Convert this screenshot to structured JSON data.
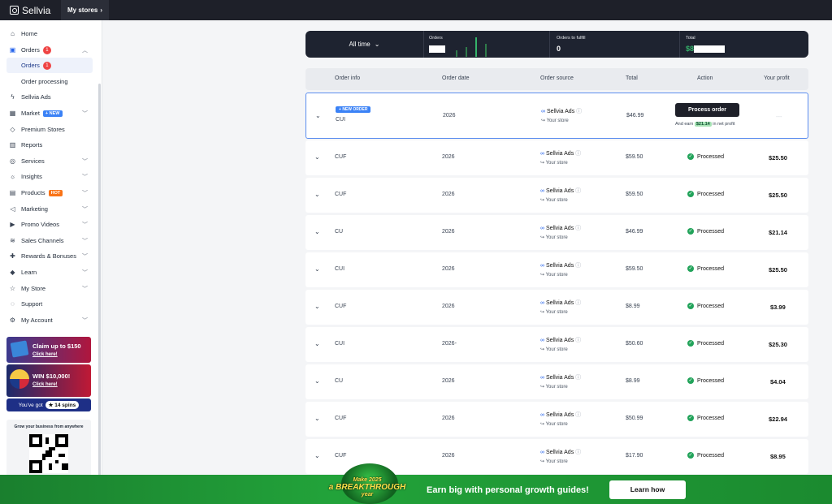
{
  "app": {
    "brand": "Sellvia",
    "store_switch": "My stores"
  },
  "sidebar": {
    "items": [
      {
        "label": "Home",
        "icon": "home-icon"
      },
      {
        "label": "Orders",
        "icon": "orders-icon",
        "badge": "1"
      },
      {
        "label": "Orders",
        "badge": "1",
        "sub": true
      },
      {
        "label": "Order processing",
        "sub": true
      },
      {
        "label": "Sellvia Ads",
        "icon": "ads-icon"
      },
      {
        "label": "Market",
        "icon": "market-icon",
        "badge_new": "NEW"
      },
      {
        "label": "Premium Stores",
        "icon": "tag-icon"
      },
      {
        "label": "Reports",
        "icon": "reports-icon"
      },
      {
        "label": "Services",
        "icon": "services-icon"
      },
      {
        "label": "Insights",
        "icon": "insights-icon"
      },
      {
        "label": "Products",
        "icon": "products-icon",
        "badge_hot": "HOT"
      },
      {
        "label": "Marketing",
        "icon": "megaphone-icon"
      },
      {
        "label": "Promo Videos",
        "icon": "video-icon"
      },
      {
        "label": "Sales Channels",
        "icon": "channels-icon"
      },
      {
        "label": "Rewards & Bonuses",
        "icon": "gift-icon"
      },
      {
        "label": "Learn",
        "icon": "learn-icon"
      },
      {
        "label": "My Store",
        "icon": "star-icon"
      },
      {
        "label": "Support",
        "icon": "support-icon"
      },
      {
        "label": "My Account",
        "icon": "account-icon"
      }
    ],
    "promo1": {
      "title": "Claim up to $150",
      "link": "Click here!"
    },
    "promo2": {
      "title": "WIN $10,000!",
      "link": "Click here!"
    },
    "spins": {
      "prefix": "You've got",
      "count": "14 spins"
    },
    "qr": {
      "caption": "Grow your business from anywhere"
    }
  },
  "stats": {
    "period": "All time",
    "orders_label": "Orders",
    "to_fulfill_label": "Orders to fulfill",
    "to_fulfill_value": "0",
    "total_label": "Total",
    "total_prefix": "$8"
  },
  "table": {
    "headers": [
      "Order info",
      "Order date",
      "Order source",
      "Total",
      "Action",
      "Your profit"
    ],
    "new_order_badge": "NEW ORDER",
    "process_button": "Process order",
    "earn_prefix": "And earn",
    "earn_amount": "$21.14",
    "earn_suffix": "in net profit",
    "empty_profit": "---",
    "rows": [
      {
        "order": "CUI",
        "date": "2026",
        "source": "Sellvia Ads",
        "store": "Your store",
        "total": "$46.99",
        "status": "",
        "profit": ""
      },
      {
        "order": "CUF",
        "date": "2026",
        "source": "Sellvia Ads",
        "store": "Your store",
        "total": "$59.50",
        "status": "Processed",
        "profit": "$25.50"
      },
      {
        "order": "CUF",
        "date": "2026",
        "source": "Sellvia Ads",
        "store": "Your store",
        "total": "$59.50",
        "status": "Processed",
        "profit": "$25.50"
      },
      {
        "order": "CU",
        "date": "2026",
        "source": "Sellvia Ads",
        "store": "Your store",
        "total": "$46.99",
        "status": "Processed",
        "profit": "$21.14"
      },
      {
        "order": "CUI",
        "date": "2026",
        "source": "Sellvia Ads",
        "store": "Your store",
        "total": "$59.50",
        "status": "Processed",
        "profit": "$25.50"
      },
      {
        "order": "CUF",
        "date": "2026",
        "source": "Sellvia Ads",
        "store": "Your store",
        "total": "$8.99",
        "status": "Processed",
        "profit": "$3.99"
      },
      {
        "order": "CUI",
        "date": "2026-",
        "source": "Sellvia Ads",
        "store": "Your store",
        "total": "$50.60",
        "status": "Processed",
        "profit": "$25.30"
      },
      {
        "order": "CU",
        "date": "2026",
        "source": "Sellvia Ads",
        "store": "Your store",
        "total": "$8.99",
        "status": "Processed",
        "profit": "$4.04"
      },
      {
        "order": "CUF",
        "date": "2026",
        "source": "Sellvia Ads",
        "store": "Your store",
        "total": "$50.99",
        "status": "Processed",
        "profit": "$22.94"
      },
      {
        "order": "CUF",
        "date": "2026",
        "source": "Sellvia Ads",
        "store": "Your store",
        "total": "$17.90",
        "status": "Processed",
        "profit": "$8.95"
      }
    ]
  },
  "banner": {
    "art_line1": "Make 2025",
    "art_line2": "a BREAKTHROUGH",
    "art_line3": "year",
    "text": "Earn big with personal growth guides!",
    "button": "Learn how"
  },
  "colors": {
    "accent": "#3b82f6",
    "dark": "#1e2029",
    "processed": "#22a35a",
    "banner": "#22a33a"
  }
}
